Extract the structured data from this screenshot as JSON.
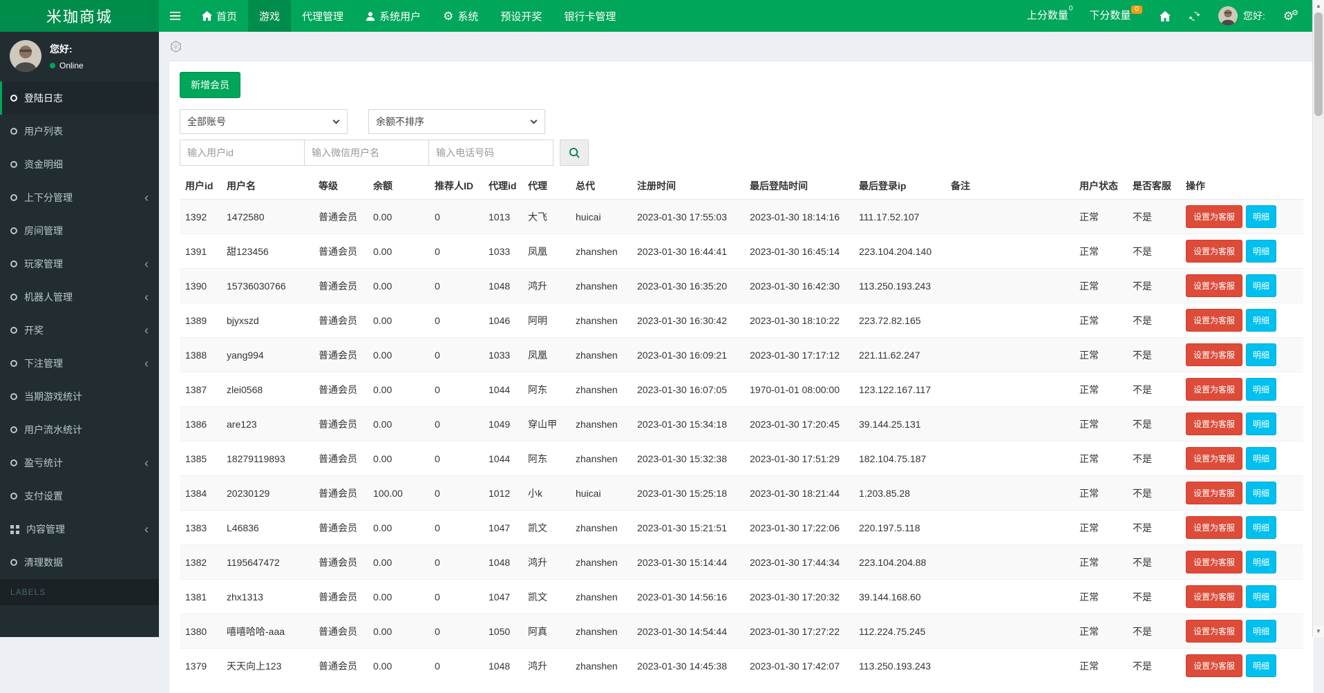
{
  "app": {
    "title": "米珈商城"
  },
  "navbar": {
    "items": [
      {
        "label": "首页",
        "icon": "home",
        "active": false
      },
      {
        "label": "游戏",
        "icon": null,
        "active": true
      },
      {
        "label": "代理管理",
        "icon": null,
        "active": false
      },
      {
        "label": "系统用户",
        "icon": "user",
        "active": false
      },
      {
        "label": "系统",
        "icon": "gear",
        "active": false
      },
      {
        "label": "预设开奖",
        "icon": null,
        "active": false
      },
      {
        "label": "银行卡管理",
        "icon": null,
        "active": false
      }
    ],
    "up_label": "上分数量",
    "up_count": "0",
    "down_label": "下分数量",
    "down_count": "0",
    "greeting": "您好:"
  },
  "sidebar": {
    "greeting": "您好:",
    "status": "Online",
    "labels_header": "LABELS",
    "items": [
      {
        "label": "登陆日志",
        "icon": "circle",
        "active": true,
        "has_children": false
      },
      {
        "label": "用户列表",
        "icon": "circle",
        "active": false,
        "has_children": false
      },
      {
        "label": "资金明细",
        "icon": "circle",
        "active": false,
        "has_children": false
      },
      {
        "label": "上下分管理",
        "icon": "circle",
        "active": false,
        "has_children": true
      },
      {
        "label": "房间管理",
        "icon": "circle",
        "active": false,
        "has_children": false
      },
      {
        "label": "玩家管理",
        "icon": "circle",
        "active": false,
        "has_children": true
      },
      {
        "label": "机器人管理",
        "icon": "circle",
        "active": false,
        "has_children": true
      },
      {
        "label": "开奖",
        "icon": "circle",
        "active": false,
        "has_children": true
      },
      {
        "label": "下注管理",
        "icon": "circle",
        "active": false,
        "has_children": true
      },
      {
        "label": "当期游戏统计",
        "icon": "circle",
        "active": false,
        "has_children": false
      },
      {
        "label": "用户流水统计",
        "icon": "circle",
        "active": false,
        "has_children": false
      },
      {
        "label": "盈亏统计",
        "icon": "circle",
        "active": false,
        "has_children": true
      },
      {
        "label": "支付设置",
        "icon": "circle",
        "active": false,
        "has_children": false
      },
      {
        "label": "内容管理",
        "icon": "grid",
        "active": false,
        "has_children": true
      },
      {
        "label": "清理数据",
        "icon": "circle",
        "active": false,
        "has_children": false
      }
    ]
  },
  "content": {
    "add_button": "新增会员",
    "filters": {
      "account_select": "全部账号",
      "sort_select": "余额不排序",
      "user_id_placeholder": "输入用户id",
      "wechat_placeholder": "输入微信用户名",
      "phone_placeholder": "输入电话号码"
    },
    "table": {
      "headers": [
        "用户id",
        "用户名",
        "等级",
        "余额",
        "推荐人ID",
        "代理id",
        "代理",
        "总代",
        "注册时间",
        "最后登陆时间",
        "最后登录ip",
        "备注",
        "用户状态",
        "是否客服",
        "操作"
      ],
      "action_labels": {
        "set_service": "设置为客服",
        "detail": "明细"
      },
      "rows": [
        [
          "1392",
          "1472580",
          "普通会员",
          "0.00",
          "0",
          "1013",
          "大飞",
          "huicai",
          "2023-01-30 17:55:03",
          "2023-01-30 18:14:16",
          "111.17.52.107",
          "",
          "正常",
          "不是"
        ],
        [
          "1391",
          "甜123456",
          "普通会员",
          "0.00",
          "0",
          "1033",
          "凤凰",
          "zhanshen",
          "2023-01-30 16:44:41",
          "2023-01-30 16:45:14",
          "223.104.204.140",
          "",
          "正常",
          "不是"
        ],
        [
          "1390",
          "15736030766",
          "普通会员",
          "0.00",
          "0",
          "1048",
          "鸿升",
          "zhanshen",
          "2023-01-30 16:35:20",
          "2023-01-30 16:42:30",
          "113.250.193.243",
          "",
          "正常",
          "不是"
        ],
        [
          "1389",
          "bjyxszd",
          "普通会员",
          "0.00",
          "0",
          "1046",
          "阿明",
          "zhanshen",
          "2023-01-30 16:30:42",
          "2023-01-30 18:10:22",
          "223.72.82.165",
          "",
          "正常",
          "不是"
        ],
        [
          "1388",
          "yang994",
          "普通会员",
          "0.00",
          "0",
          "1033",
          "凤凰",
          "zhanshen",
          "2023-01-30 16:09:21",
          "2023-01-30 17:17:12",
          "221.11.62.247",
          "",
          "正常",
          "不是"
        ],
        [
          "1387",
          "zlei0568",
          "普通会员",
          "0.00",
          "0",
          "1044",
          "阿东",
          "zhanshen",
          "2023-01-30 16:07:05",
          "1970-01-01 08:00:00",
          "123.122.167.117",
          "",
          "正常",
          "不是"
        ],
        [
          "1386",
          "are123",
          "普通会员",
          "0.00",
          "0",
          "1049",
          "穿山甲",
          "zhanshen",
          "2023-01-30 15:34:18",
          "2023-01-30 17:20:45",
          "39.144.25.131",
          "",
          "正常",
          "不是"
        ],
        [
          "1385",
          "18279119893",
          "普通会员",
          "0.00",
          "0",
          "1044",
          "阿东",
          "zhanshen",
          "2023-01-30 15:32:38",
          "2023-01-30 17:51:29",
          "182.104.75.187",
          "",
          "正常",
          "不是"
        ],
        [
          "1384",
          "20230129",
          "普通会员",
          "100.00",
          "0",
          "1012",
          "小k",
          "huicai",
          "2023-01-30 15:25:18",
          "2023-01-30 18:21:44",
          "1.203.85.28",
          "",
          "正常",
          "不是"
        ],
        [
          "1383",
          "L46836",
          "普通会员",
          "0.00",
          "0",
          "1047",
          "凯文",
          "zhanshen",
          "2023-01-30 15:21:51",
          "2023-01-30 17:22:06",
          "220.197.5.118",
          "",
          "正常",
          "不是"
        ],
        [
          "1382",
          "1195647472",
          "普通会员",
          "0.00",
          "0",
          "1048",
          "鸿升",
          "zhanshen",
          "2023-01-30 15:14:44",
          "2023-01-30 17:44:34",
          "223.104.204.88",
          "",
          "正常",
          "不是"
        ],
        [
          "1381",
          "zhx1313",
          "普通会员",
          "0.00",
          "0",
          "1047",
          "凯文",
          "zhanshen",
          "2023-01-30 14:56:16",
          "2023-01-30 17:20:32",
          "39.144.168.60",
          "",
          "正常",
          "不是"
        ],
        [
          "1380",
          "嘻嘻哈哈-aaa",
          "普通会员",
          "0.00",
          "0",
          "1050",
          "阿真",
          "zhanshen",
          "2023-01-30 14:54:44",
          "2023-01-30 17:27:22",
          "112.224.75.245",
          "",
          "正常",
          "不是"
        ],
        [
          "1379",
          "天天向上123",
          "普通会员",
          "0.00",
          "0",
          "1048",
          "鸿升",
          "zhanshen",
          "2023-01-30 14:45:38",
          "2023-01-30 17:42:07",
          "113.250.193.243",
          "",
          "正常",
          "不是"
        ]
      ]
    }
  },
  "colors": {
    "primary_green": "#00a65a",
    "dark_green": "#008d4c",
    "sidebar_bg": "#222d32",
    "badge_orange": "#f39c12",
    "danger_red": "#dd4b39",
    "info_blue": "#00c0ef"
  }
}
